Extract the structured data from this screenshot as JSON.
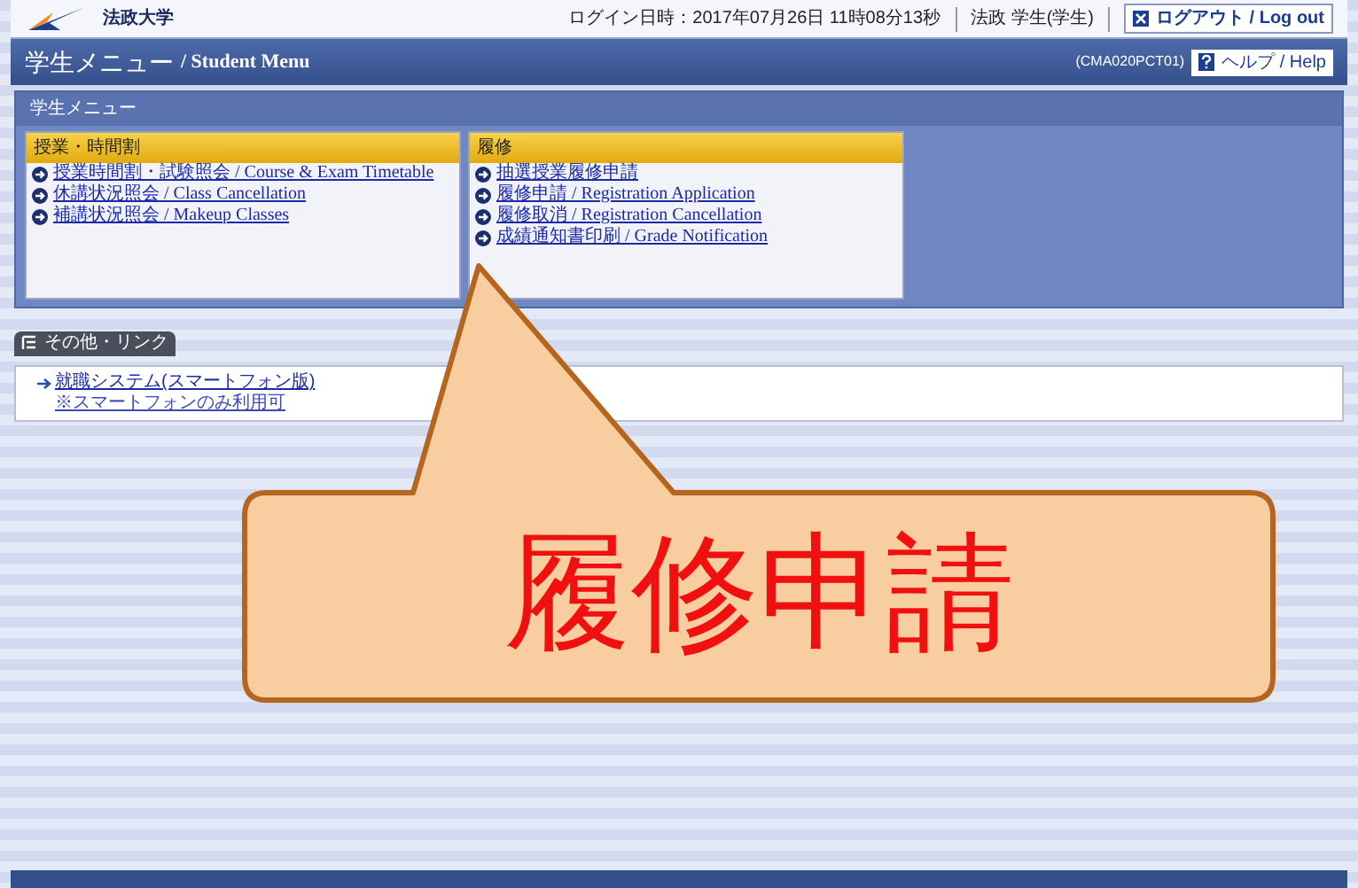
{
  "header": {
    "university_name": "法政大学",
    "login_time": "ログイン日時：2017年07月26日 11時08分13秒",
    "user": "法政 学生(学生)",
    "logout_button": "ログアウト / Log out"
  },
  "title_bar": {
    "title_ja": "学生メニュー",
    "title_en": "/ Student Menu",
    "screen_code": "(CMA020PCT01)",
    "help_button": "ヘルプ / Help"
  },
  "menu_section": {
    "title": "学生メニュー",
    "panels": [
      {
        "title": "授業・時間割",
        "links": [
          "授業時間割・試験照会 / Course & Exam Timetable",
          "休講状況照会 / Class Cancellation",
          "補講状況照会 / Makeup Classes"
        ]
      },
      {
        "title": "履修",
        "links": [
          "抽選授業履修申請",
          "履修申請 / Registration Application",
          "履修取消 / Registration Cancellation",
          "成績通知書印刷 / Grade Notification"
        ]
      }
    ]
  },
  "other_section": {
    "tab": "その他・リンク",
    "links": [
      {
        "text": "就職システム(スマートフォン版)",
        "note": "※スマートフォンのみ利用可"
      }
    ]
  },
  "callout": {
    "text": "履修申請"
  }
}
